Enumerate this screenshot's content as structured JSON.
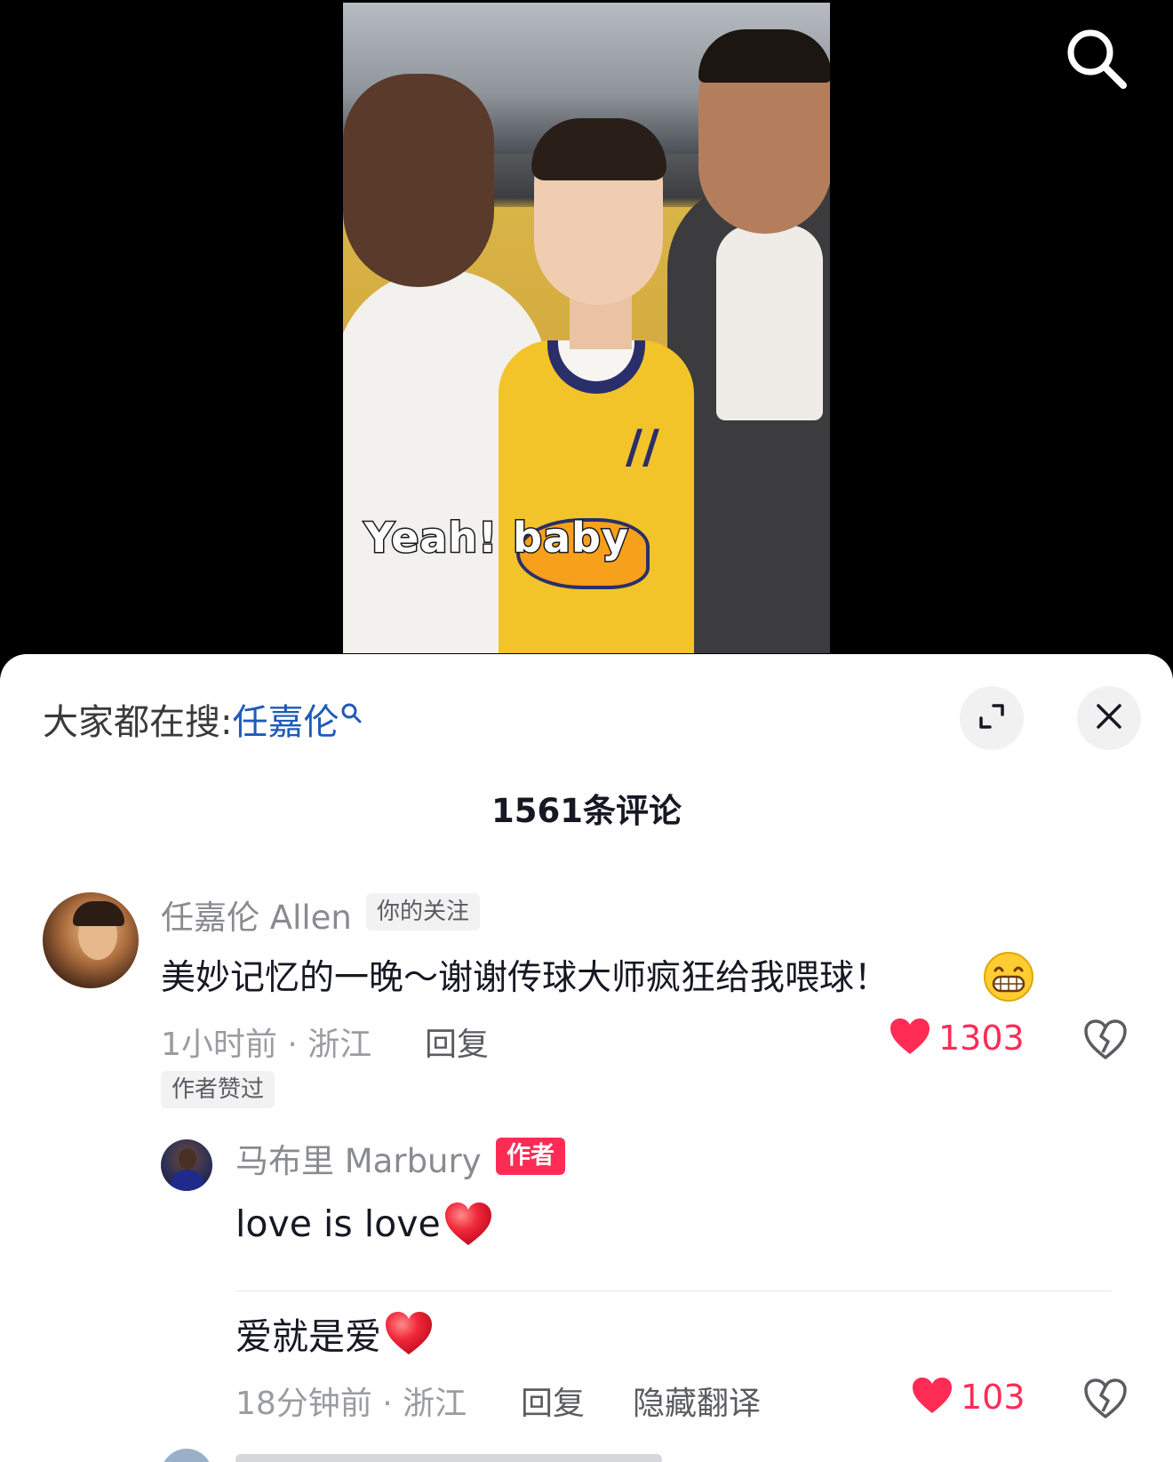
{
  "video": {
    "subtitle": "Yeah! baby",
    "search_icon": "search-icon"
  },
  "sheet": {
    "hot_search_prefix": "大家都在搜:",
    "hot_search_keyword": "任嘉伦",
    "expand_icon": "expand-icon",
    "close_icon": "close-icon",
    "comment_count": "1561条评论"
  },
  "comments": [
    {
      "author": "任嘉伦 Allen",
      "tag": "你的关注",
      "text": "美妙记忆的一晚～谢谢传球大师疯狂给我喂球！",
      "emoji": "grinning-face-icon",
      "meta": "1小时前 · 浙江",
      "reply_label": "回复",
      "likes": "1303",
      "author_liked": "作者赞过",
      "replies": [
        {
          "author": "马布里 Marbury",
          "tag": "作者",
          "text": "love is love",
          "translation": "爱就是爱",
          "meta": "18分钟前 · 浙江",
          "reply_label": "回复",
          "hide_translation_label": "隐藏翻译",
          "likes": "103"
        }
      ]
    }
  ],
  "colors": {
    "accent_red": "#fe2c55",
    "keyword_blue": "#1d5bb8",
    "text_primary": "#161823",
    "text_secondary": "#8a8b91"
  }
}
